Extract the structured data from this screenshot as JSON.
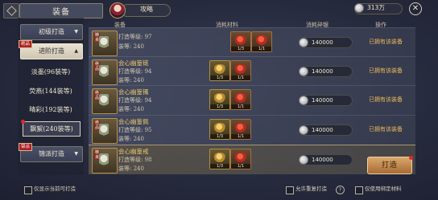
{
  "header": {
    "title": "装备",
    "guide_label": "攻略",
    "currency_amount": "313万",
    "close_glyph": "✕"
  },
  "sidebar": {
    "items": [
      {
        "label": "初级打造",
        "tag": "",
        "state": "collapsed"
      },
      {
        "label": "进阶打造",
        "tag": "绝品",
        "state": "expanded"
      },
      {
        "label": "淡墨(96装等)"
      },
      {
        "label": "荧燕(144装等)"
      },
      {
        "label": "晴彩(192装等)"
      },
      {
        "label": "飘絮(240装等)"
      },
      {
        "label": "锦派打造",
        "tag": "锦派",
        "state": "collapsed"
      }
    ]
  },
  "columns": {
    "equip": "装备",
    "materials": "消耗材料",
    "silver": "消耗碎银",
    "action": "操作"
  },
  "rows": [
    {
      "tag": "精良",
      "name": "",
      "forge_level": "打造等级: 97",
      "equip_level": "装等: 240",
      "mat1": "1/3",
      "mat2": "1/1",
      "silver": "140000",
      "status": "已拥有该装备"
    },
    {
      "tag": "绝品",
      "name": "会心幽篁链",
      "forge_level": "打造等级: 94",
      "equip_level": "装等: 240",
      "mat1": "1/3",
      "mat2": "1/1",
      "silver": "140000",
      "status": "已拥有该装备"
    },
    {
      "tag": "绝品",
      "name": "会心幽篁镯",
      "forge_level": "打造等级: 94",
      "equip_level": "装等: 240",
      "mat1": "1/3",
      "mat2": "1/1",
      "silver": "140000",
      "status": "已拥有该装备"
    },
    {
      "tag": "绝品",
      "name": "会心幽篁佩",
      "forge_level": "打造等级: 95",
      "equip_level": "装等: 240",
      "mat1": "1/3",
      "mat2": "1/1",
      "silver": "140000",
      "status": "已拥有该装备"
    },
    {
      "tag": "精良",
      "name": "会心幽篁戒",
      "forge_level": "打造等级: 98",
      "equip_level": "装等: 240",
      "mat1": "1/3",
      "mat2": "1/1",
      "silver": "140000",
      "status": ""
    }
  ],
  "forge_button": "打造",
  "footer": {
    "show_craftable": "仅显示当前可打造",
    "allow_repeat": "允许重复打造",
    "use_bound": "仅使用绑定材料",
    "help_glyph": "?"
  }
}
